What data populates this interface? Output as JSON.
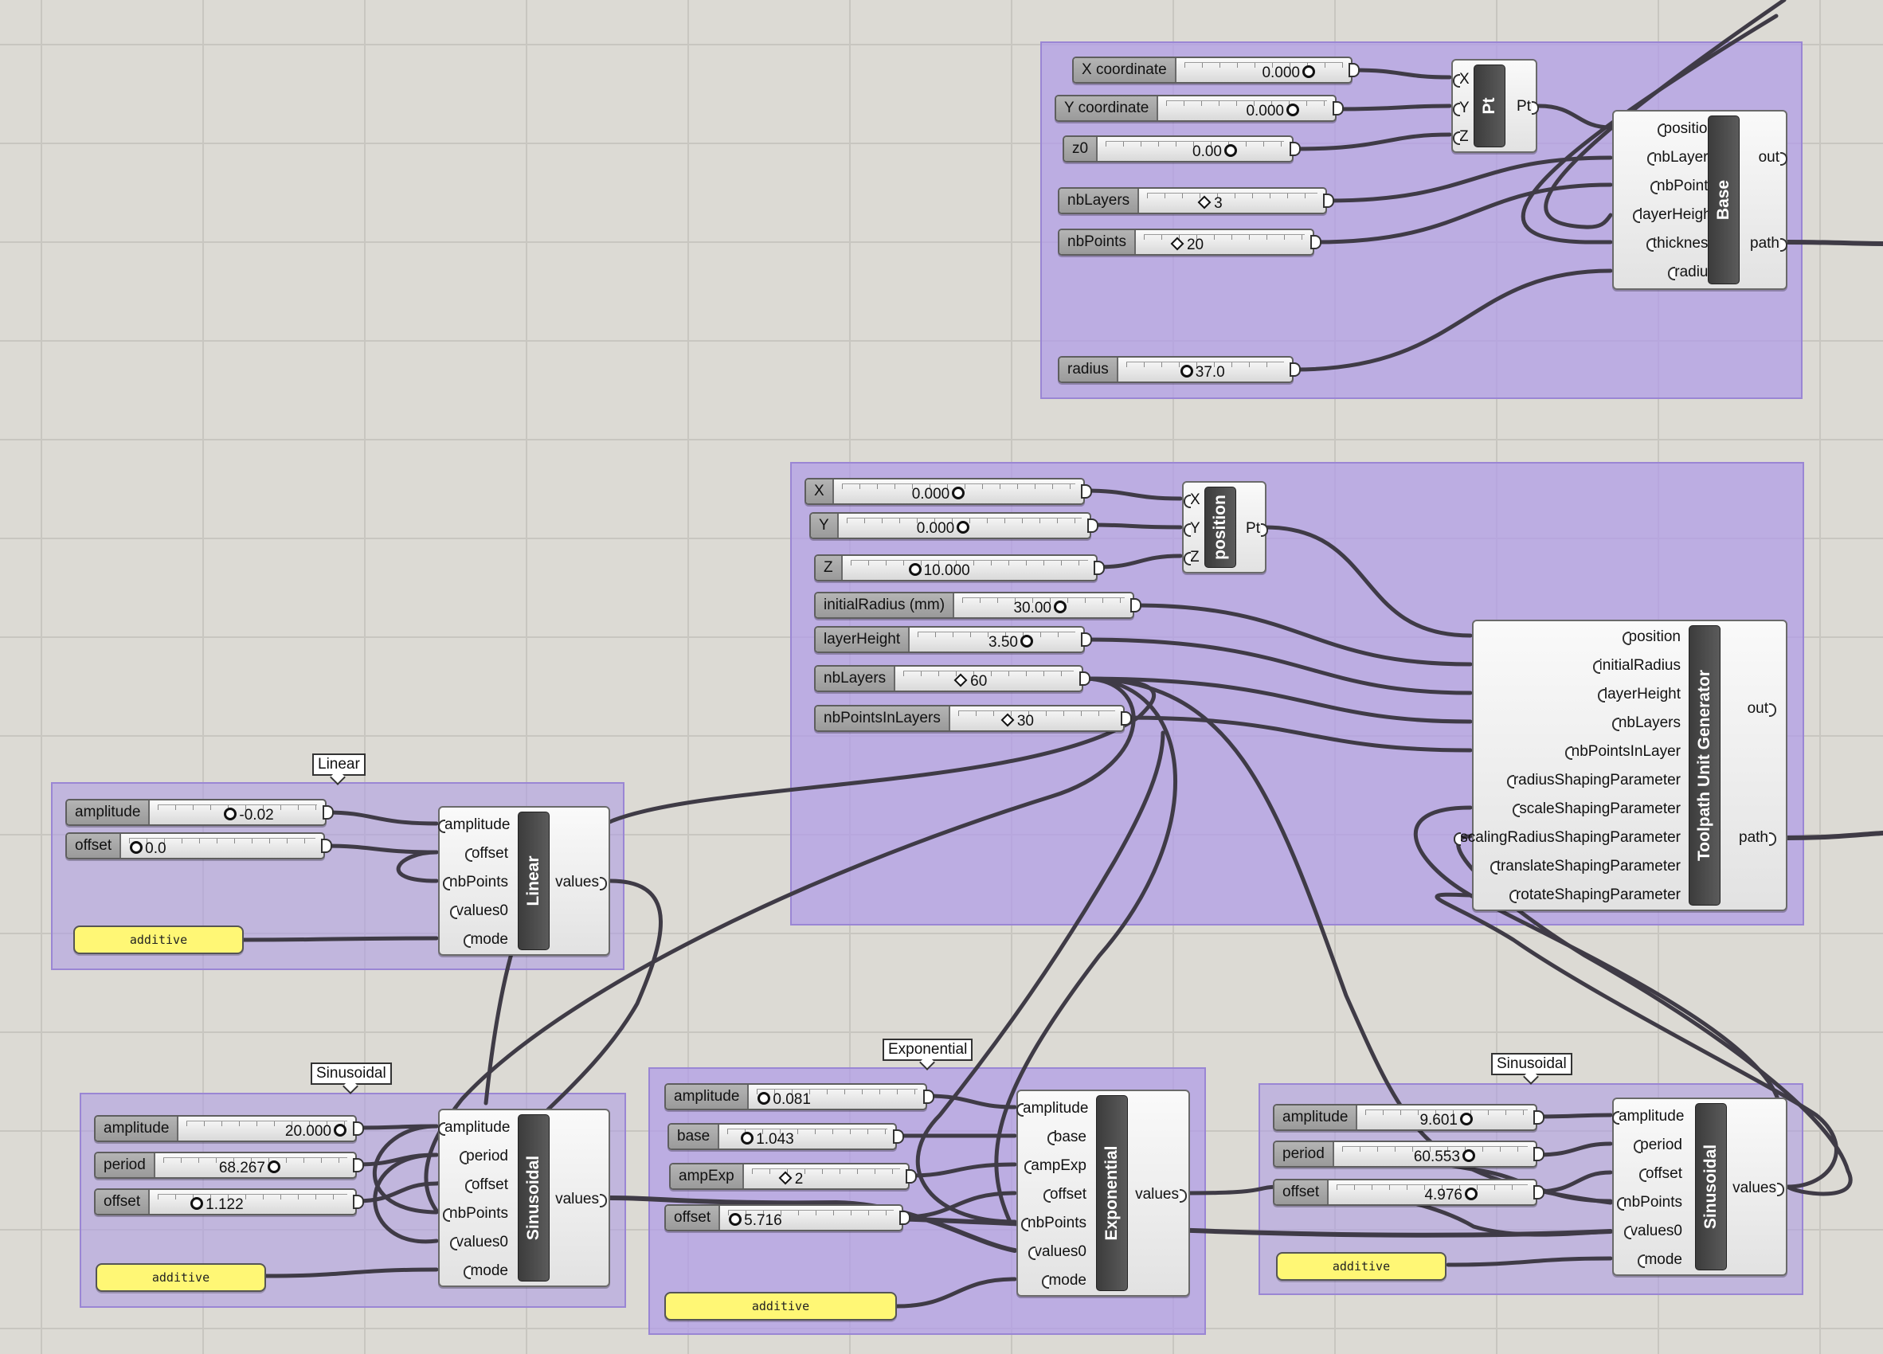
{
  "colors": {
    "canvas": "#dcdad4",
    "group": "#b09be8",
    "panel": "#fff775",
    "wire": "#3f3b46"
  },
  "base_group": {
    "sliders": [
      {
        "label": "X coordinate",
        "value": "0.000",
        "kind": "knob"
      },
      {
        "label": "Y coordinate",
        "value": "0.000",
        "kind": "knob"
      },
      {
        "label": "z0",
        "value": "0.00",
        "kind": "knob"
      },
      {
        "label": "nbLayers",
        "value": "3",
        "kind": "int"
      },
      {
        "label": "nbPoints",
        "value": "20",
        "kind": "int"
      },
      {
        "label": "radius",
        "value": "37.0",
        "kind": "knob"
      }
    ],
    "pt": {
      "title": "Pt",
      "inputs": [
        "X",
        "Y",
        "Z"
      ],
      "outputs": [
        "Pt"
      ]
    },
    "base": {
      "title": "Base",
      "inputs": [
        "position",
        "nbLayers",
        "nbPoints",
        "layerHeight",
        "thickness",
        "radius"
      ],
      "outputs": [
        "out",
        "path"
      ]
    }
  },
  "toolpath_group": {
    "sliders": [
      {
        "label": "X",
        "value": "0.000",
        "kind": "knob"
      },
      {
        "label": "Y",
        "value": "0.000",
        "kind": "knob"
      },
      {
        "label": "Z",
        "value": "10.000",
        "kind": "knob"
      },
      {
        "label": "initialRadius (mm)",
        "value": "30.00",
        "kind": "knob"
      },
      {
        "label": "layerHeight",
        "value": "3.50",
        "kind": "knob"
      },
      {
        "label": "nbLayers",
        "value": "60",
        "kind": "int"
      },
      {
        "label": "nbPointsInLayers",
        "value": "30",
        "kind": "int"
      }
    ],
    "position": {
      "title": "position",
      "inputs": [
        "X",
        "Y",
        "Z"
      ],
      "outputs": [
        "Pt"
      ]
    },
    "generator": {
      "title": "Toolpath Unit Generator",
      "inputs": [
        "position",
        "initialRadius",
        "layerHeight",
        "nbLayers",
        "nbPointsInLayer",
        "radiusShapingParameter",
        "scaleShapingParameter",
        "scalingRadiusShapingParameter",
        "translateShapingParameter",
        "rotateShapingParameter"
      ],
      "outputs": [
        "out",
        "path"
      ]
    }
  },
  "linear_group": {
    "callout": "Linear",
    "sliders": [
      {
        "label": "amplitude",
        "value": "-0.02",
        "kind": "knob"
      },
      {
        "label": "offset",
        "value": "0.0",
        "kind": "knob"
      }
    ],
    "panel": "additive",
    "comp": {
      "title": "Linear",
      "inputs": [
        "amplitude",
        "offset",
        "nbPoints",
        "values0",
        "mode"
      ],
      "outputs": [
        "values"
      ]
    }
  },
  "sinusoidal1_group": {
    "callout": "Sinusoidal",
    "sliders": [
      {
        "label": "amplitude",
        "value": "20.000",
        "kind": "knob"
      },
      {
        "label": "period",
        "value": "68.267",
        "kind": "knob"
      },
      {
        "label": "offset",
        "value": "1.122",
        "kind": "knob"
      }
    ],
    "panel": "additive",
    "comp": {
      "title": "Sinusoidal",
      "inputs": [
        "amplitude",
        "period",
        "offset",
        "nbPoints",
        "values0",
        "mode"
      ],
      "outputs": [
        "values"
      ]
    }
  },
  "exponential_group": {
    "callout": "Exponential",
    "sliders": [
      {
        "label": "amplitude",
        "value": "0.081",
        "kind": "knob"
      },
      {
        "label": "base",
        "value": "1.043",
        "kind": "knob"
      },
      {
        "label": "ampExp",
        "value": "2",
        "kind": "int"
      },
      {
        "label": "offset",
        "value": "5.716",
        "kind": "knob"
      }
    ],
    "panel": "additive",
    "comp": {
      "title": "Exponential",
      "inputs": [
        "amplitude",
        "base",
        "ampExp",
        "offset",
        "nbPoints",
        "values0",
        "mode"
      ],
      "outputs": [
        "values"
      ]
    }
  },
  "sinusoidal2_group": {
    "callout": "Sinusoidal",
    "sliders": [
      {
        "label": "amplitude",
        "value": "9.601",
        "kind": "knob"
      },
      {
        "label": "period",
        "value": "60.553",
        "kind": "knob"
      },
      {
        "label": "offset",
        "value": "4.976",
        "kind": "knob"
      }
    ],
    "panel": "additive",
    "comp": {
      "title": "Sinusoidal",
      "inputs": [
        "amplitude",
        "period",
        "offset",
        "nbPoints",
        "values0",
        "mode"
      ],
      "outputs": [
        "values"
      ]
    }
  }
}
